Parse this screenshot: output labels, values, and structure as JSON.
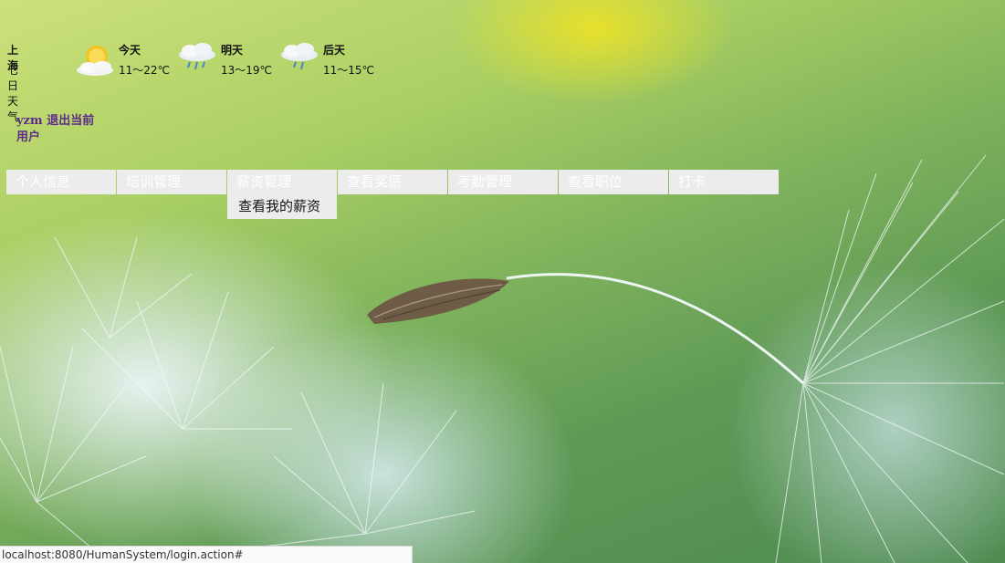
{
  "weather": {
    "city": "上海",
    "subtitle": "七日天气",
    "days": [
      {
        "label": "今天",
        "temp": "11～22℃",
        "icon": "sunny-cloud-icon"
      },
      {
        "label": "明天",
        "temp": "13～19℃",
        "icon": "rain-cloud-icon"
      },
      {
        "label": "后天",
        "temp": "11～15℃",
        "icon": "rain-cloud-icon"
      }
    ]
  },
  "user": {
    "name": "yzm",
    "logout_label": "退出当前用户"
  },
  "nav": {
    "items": [
      {
        "label": "个人信息"
      },
      {
        "label": "培训管理"
      },
      {
        "label": "薪资管理"
      },
      {
        "label": "查看奖惩"
      },
      {
        "label": "考勤管理"
      },
      {
        "label": "查看职位"
      },
      {
        "label": "打卡"
      }
    ],
    "dropdown": {
      "items": [
        {
          "label": "查看我的薪资"
        }
      ]
    }
  },
  "status": {
    "url": "localhost:8080/HumanSystem/login.action#"
  },
  "colors": {
    "menu_bg": "#ececec",
    "menu_text": "#ffffff",
    "user_text": "#5b2a8a"
  }
}
